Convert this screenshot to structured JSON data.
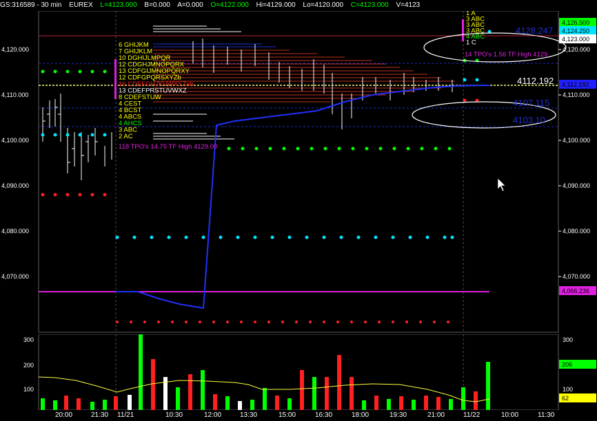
{
  "header": {
    "symbol": "GS:316589 - 30 min",
    "exchange": "EUREX",
    "last": "L=4123.000",
    "bid": "B=0.000",
    "ask": "A=0.000",
    "open": "O=4122.000",
    "high": "Hi=4129.000",
    "low": "Lo=4120.000",
    "close": "C=4123.000",
    "volume": "V=4123"
  },
  "colors": {
    "background": "#000000",
    "green": "#00ff00",
    "red": "#ff2020",
    "cyan": "#00e5ff",
    "blue": "#2020ff",
    "magenta": "#e020e0",
    "yellow": "#ffff00"
  },
  "price_axis": {
    "ticks": [
      "4,120.000",
      "4,110.000",
      "4,100.000",
      "4,090.000",
      "4,080.000",
      "4,070.000"
    ]
  },
  "price_badges": [
    {
      "text": "4,126.500",
      "bg": "#00ff00",
      "fg": "#000000"
    },
    {
      "text": "4,124.250",
      "bg": "#00e5ff",
      "fg": "#000000"
    },
    {
      "text": "4,123.000",
      "bg": "#ffffff",
      "fg": "#000000"
    },
    {
      "text": "4,112.192",
      "bg": "#2020ff",
      "fg": "#000000"
    },
    {
      "text": "4,066.236",
      "bg": "#e020e0",
      "fg": "#000000"
    }
  ],
  "levels": {
    "l_4128": "4128.247",
    "l_4112": "4112.192",
    "l_4107": "4107.115",
    "l_4103": "4103.10"
  },
  "profile_main": {
    "letters": [
      {
        "text": "6 GHIJKM",
        "color": "#ffff00"
      },
      {
        "text": "7 GHIJKLM",
        "color": "#ffff00"
      },
      {
        "text": "10 DGHIJLMPQR",
        "color": "#ffff00"
      },
      {
        "text": "12 CDGHJMNOPQRX",
        "color": "#ffff00"
      },
      {
        "text": "13 CDFGIJMNOPQRXY",
        "color": "#ffff00"
      },
      {
        "text": "12 CDFGPQRSXYZb",
        "color": "#ffff00"
      },
      {
        "text": "16 CDEFGHJKVWXYZab",
        "color": "#ff2020"
      },
      {
        "text": "13 CDEFPRSTUVWXZ",
        "color": "#ffffff"
      },
      {
        "text": "8 CDEFSTUW",
        "color": "#ffff00"
      },
      {
        "text": "4 CEST",
        "color": "#ffff00"
      },
      {
        "text": "4 BCST",
        "color": "#ffff00"
      },
      {
        "text": "4 ABCS",
        "color": "#ffff00"
      },
      {
        "text": "4 AHCS",
        "color": "#00ff00"
      },
      {
        "text": "3 ABC",
        "color": "#ffff00"
      },
      {
        "text": "2 AC",
        "color": "#ffff00"
      }
    ],
    "summary": "118 TPO's 14.75 TF High 4129.00"
  },
  "profile_current": {
    "letters": [
      {
        "text": "1 A",
        "color": "#ffff00"
      },
      {
        "text": "3 ABC",
        "color": "#ffff00"
      },
      {
        "text": "3 ABC",
        "color": "#ffff00"
      },
      {
        "text": "3 ABC",
        "color": "#ffff00"
      },
      {
        "text": "4 ABC",
        "color": "#00ff00"
      },
      {
        "text": "1 C",
        "color": "#ffffff"
      }
    ],
    "summary": "14 TPO's 1.56 TF High 4129"
  },
  "volume_axis": {
    "ticks": [
      "300",
      "200",
      "100"
    ],
    "badges": [
      {
        "text": "206",
        "bg": "#00ff00",
        "fg": "#000000"
      },
      {
        "text": "62",
        "bg": "#ffff00",
        "fg": "#000000"
      }
    ]
  },
  "time_axis": [
    "20:00",
    "21:30",
    "11/21",
    "10:30",
    "12:00",
    "13:30",
    "15:00",
    "16:30",
    "18:00",
    "19:30",
    "21:00",
    "11/22",
    "10:00",
    "11:30"
  ]
}
